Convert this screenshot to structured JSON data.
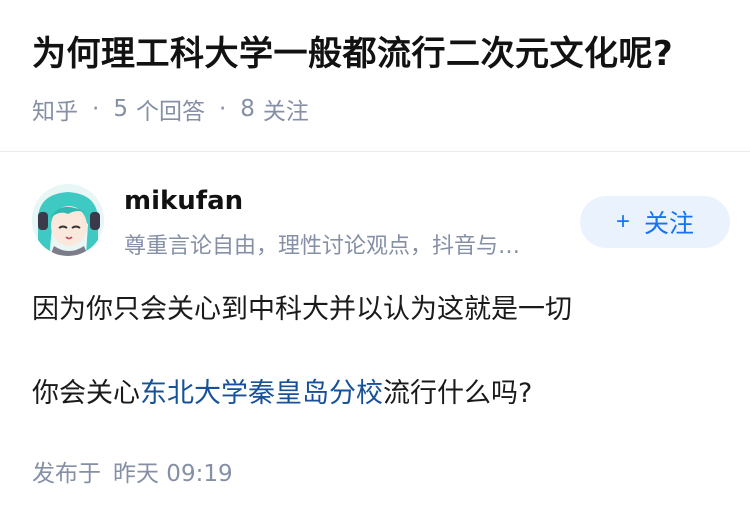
{
  "question": {
    "title": "为何理工科大学一般都流行二次元文化呢?",
    "source": "知乎",
    "answer_count": "5",
    "answer_label": "个回答",
    "follower_count": "8",
    "follower_label": "关注"
  },
  "author": {
    "name": "mikufan",
    "bio": "尊重言论自由，理性讨论观点，抖音与知乎同步更新",
    "follow_label": "关注"
  },
  "answer": {
    "paragraph1": "因为你只会关心到中科大并以认为这就是一切",
    "paragraph2_before": "你会关心",
    "paragraph2_link": "东北大学秦皇岛分校",
    "paragraph2_after": "流行什么吗?"
  },
  "publish": {
    "label": "发布于",
    "time": "昨天 09:19"
  },
  "colors": {
    "accent": "#1772f6",
    "link": "#175199",
    "meta_text": "#8590a6"
  },
  "icons": {
    "avatar": "anime-avatar-teal-hair",
    "follow": "plus-icon"
  }
}
